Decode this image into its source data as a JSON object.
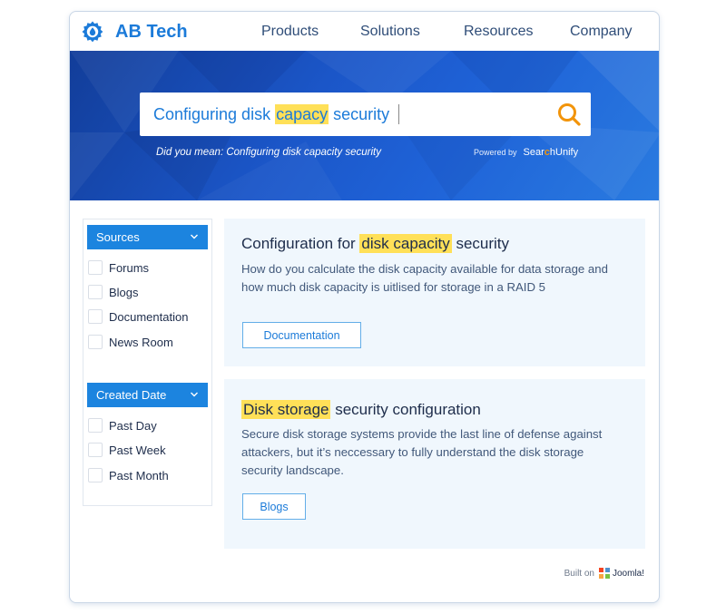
{
  "header": {
    "brand": "AB Tech",
    "nav": [
      "Products",
      "Solutions",
      "Resources",
      "Company"
    ]
  },
  "search": {
    "query_parts": [
      "Configuring disk ",
      "capacy",
      " security"
    ],
    "highlighted_term": "capacy",
    "did_you_mean": "Did you mean: Configuring disk capacity security",
    "powered_by_label": "Powered by",
    "powered_by_brand_pre": "Sear",
    "powered_by_brand_o": "c",
    "powered_by_brand_post": "hUnify"
  },
  "facets": [
    {
      "title": "Sources",
      "options": [
        "Forums",
        "Blogs",
        "Documentation",
        "News Room"
      ]
    },
    {
      "title": "Created Date",
      "options": [
        "Past Day",
        "Past Week",
        "Past Month"
      ]
    }
  ],
  "results": [
    {
      "title_pre": "Configuration for ",
      "title_hl": "disk capacity",
      "title_post": " security",
      "description": "How do you calculate the disk capacity available for data storage and how much disk capacity is uitlised for storage in a RAID 5",
      "tag": "Documentation"
    },
    {
      "title_pre": "",
      "title_hl": "Disk storage",
      "title_post": " security configuration",
      "description": "Secure disk storage systems provide the last line of defense against attackers, but it’s neccessary to fully understand the disk storage security landscape.",
      "tag": "Blogs"
    }
  ],
  "footer": {
    "built_on": "Built on",
    "platform": "Joomla!"
  },
  "colors": {
    "brand_blue": "#1c7bd9",
    "facet_blue": "#1c84df",
    "highlight": "#ffe058",
    "search_orange": "#f2940a",
    "card_bg": "#f0f7fd"
  }
}
